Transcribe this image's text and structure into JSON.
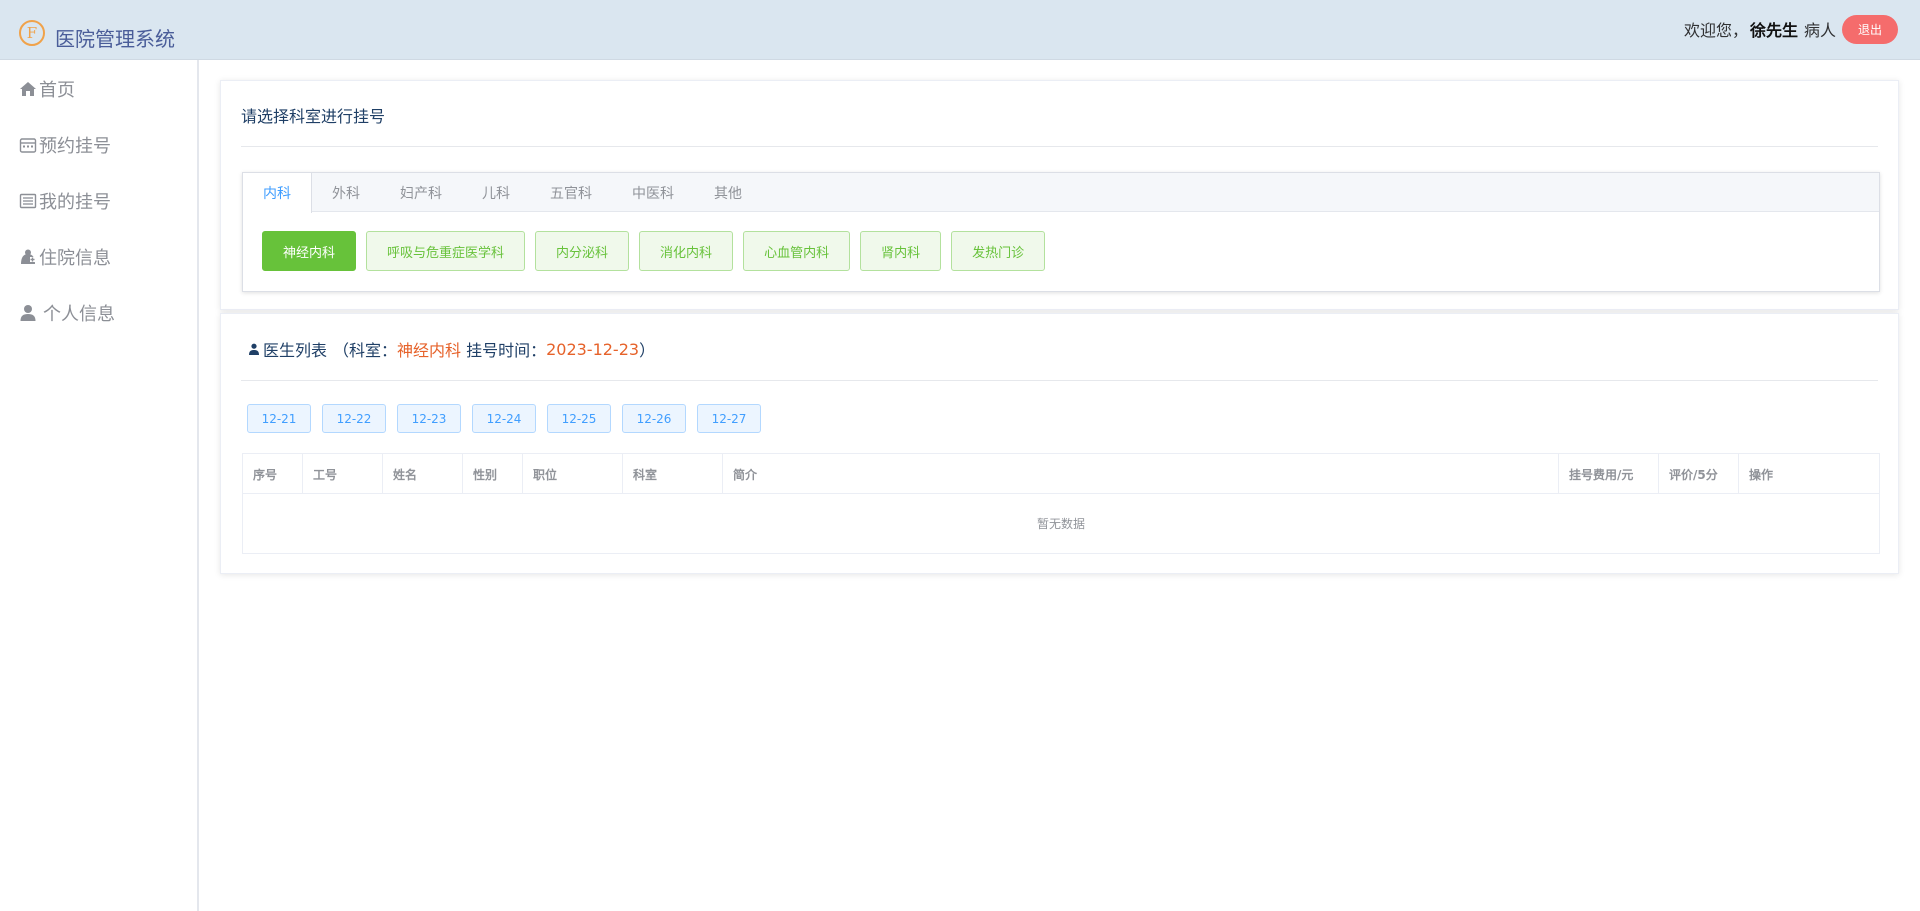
{
  "header": {
    "app_title": "医院管理系统",
    "logo_letter": "F",
    "welcome": "欢迎您，",
    "username": "徐先生",
    "role": "病人",
    "logout_label": "退出"
  },
  "sidebar": {
    "items": [
      {
        "label": "首页",
        "icon": "home-icon"
      },
      {
        "label": "预约挂号",
        "icon": "calendar-icon"
      },
      {
        "label": "我的挂号",
        "icon": "list-icon"
      },
      {
        "label": "住院信息",
        "icon": "hospital-icon"
      },
      {
        "label": "个人信息",
        "icon": "user-icon"
      }
    ]
  },
  "department_card": {
    "title": "请选择科室进行挂号",
    "tabs": [
      "内科",
      "外科",
      "妇产科",
      "儿科",
      "五官科",
      "中医科",
      "其他"
    ],
    "active_tab": "内科",
    "departments": [
      "神经内科",
      "呼吸与危重症医学科",
      "内分泌科",
      "消化内科",
      "心血管内科",
      "肾内科",
      "发热门诊"
    ],
    "active_department": "神经内科"
  },
  "doctor_card": {
    "title": "医生列表",
    "open_paren": "（",
    "dept_label": "科室：",
    "dept_value": "神经内科",
    "time_label": "挂号时间：",
    "time_value": "2023-12-23",
    "close_paren": "）",
    "dates": [
      "12-21",
      "12-22",
      "12-23",
      "12-24",
      "12-25",
      "12-26",
      "12-27"
    ],
    "columns": [
      "序号",
      "工号",
      "姓名",
      "性别",
      "职位",
      "科室",
      "简介",
      "挂号费用/元",
      "评价/5分",
      "操作"
    ],
    "empty_text": "暂无数据"
  },
  "colors": {
    "topbar_bg": "#dae6f0",
    "accent_blue": "#409eff",
    "success_green": "#67c23a",
    "danger_red": "#f56c6c",
    "highlight_orange": "#e6622a"
  }
}
